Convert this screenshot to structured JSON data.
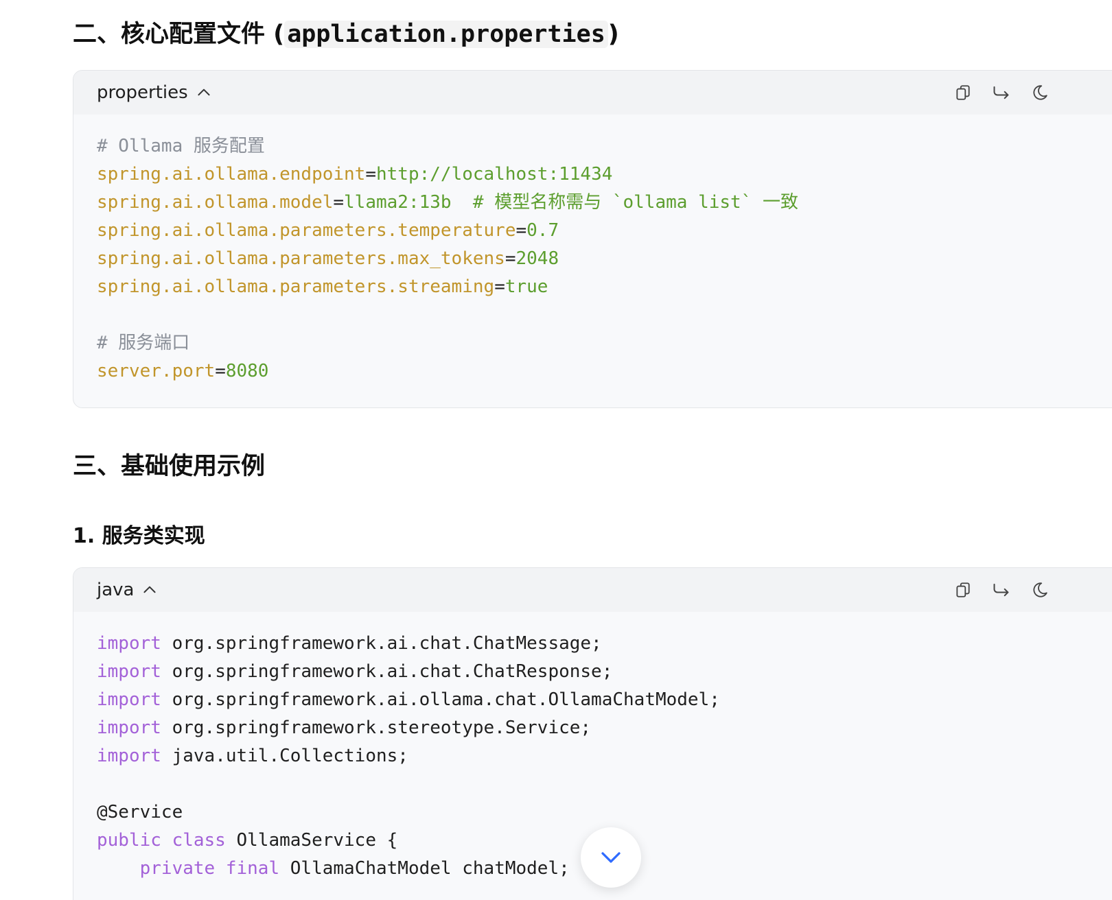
{
  "section2": {
    "title_prefix": "二、核心配置文件 (",
    "title_code": "application.properties",
    "title_suffix": ")"
  },
  "props_block": {
    "lang": "properties",
    "lines": [
      {
        "comment": "# Ollama 服务配置"
      },
      {
        "key": "spring.ai.ollama.endpoint",
        "val": "http://localhost:11434"
      },
      {
        "key": "spring.ai.ollama.model",
        "val": "llama2:13b",
        "comment": "  # 模型名称需与 `ollama list` 一致"
      },
      {
        "key": "spring.ai.ollama.parameters.temperature",
        "val": "0.7"
      },
      {
        "key": "spring.ai.ollama.parameters.max_tokens",
        "val": "2048"
      },
      {
        "key": "spring.ai.ollama.parameters.streaming",
        "val": "true"
      },
      {
        "blank": true
      },
      {
        "comment": "# 服务端口"
      },
      {
        "key": "server.port",
        "val": "8080"
      }
    ]
  },
  "section3": {
    "title": "三、基础使用示例"
  },
  "subsection1": {
    "title": "1. 服务类实现"
  },
  "java_block": {
    "lang": "java",
    "lines": [
      {
        "kw": "import",
        "rest": " org.springframework.ai.chat.ChatMessage;"
      },
      {
        "kw": "import",
        "rest": " org.springframework.ai.chat.ChatResponse;"
      },
      {
        "kw": "import",
        "rest": " org.springframework.ai.ollama.chat.OllamaChatModel;"
      },
      {
        "kw": "import",
        "rest": " org.springframework.stereotype.Service;"
      },
      {
        "kw": "import",
        "rest": " java.util.Collections;"
      },
      {
        "blank": true
      },
      {
        "plain": "@Service"
      },
      {
        "kw": "public class",
        "rest": " OllamaService {"
      },
      {
        "indent": "    ",
        "kw": "private final",
        "rest": " OllamaChatModel chatModel;"
      }
    ]
  },
  "icons": {
    "copy": "copy-icon",
    "wrap": "wrap-icon",
    "theme": "moon-icon",
    "collapse": "chevron-up-icon",
    "scroll": "chevron-down-icon"
  }
}
